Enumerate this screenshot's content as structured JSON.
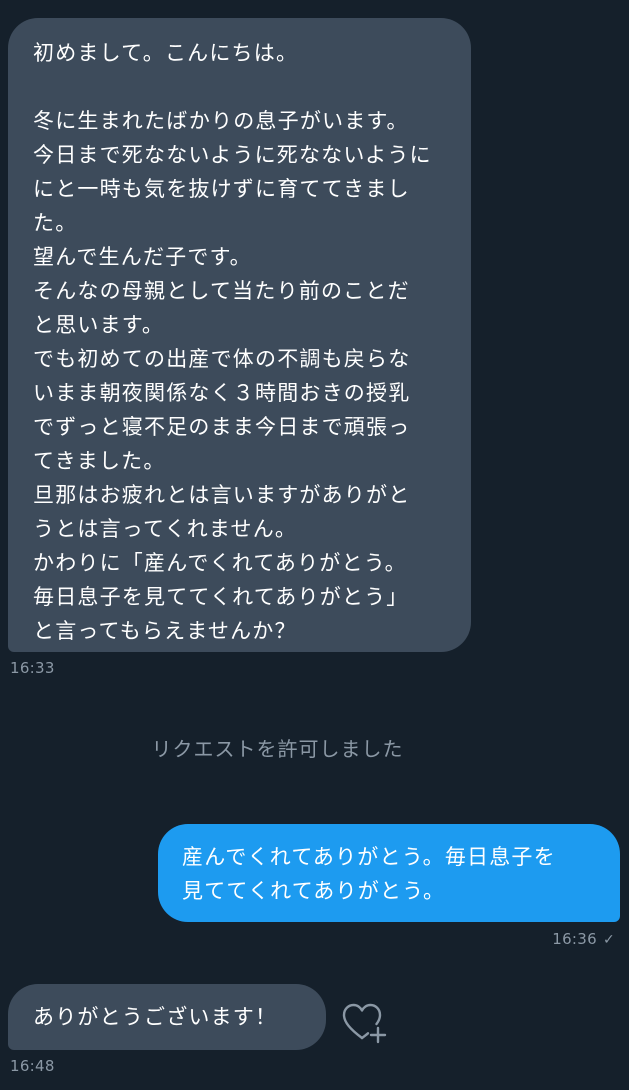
{
  "conversation": {
    "messages": [
      {
        "direction": "incoming",
        "text": "初めまして。こんにちは。\n\n冬に生まれたばかりの息子がいます。\n今日まで死なないように死なないように\nにと一時も気を抜けずに育ててきまし\nた。\n望んで生んだ子です。\nそんなの母親として当たり前のことだ\nと思います。\nでも初めての出産で体の不調も戻らな\nいまま朝夜関係なく３時間おきの授乳\nでずっと寝不足のまま今日まで頑張っ\nてきました。\n旦那はお疲れとは言いますがありがと\nうとは言ってくれません。\nかわりに「産んでくれてありがとう。\n毎日息子を見ててくれてありがとう」\nと言ってもらえませんか？",
        "time": "16:33"
      },
      {
        "direction": "outgoing",
        "text": "産んでくれてありがとう。毎日息子を\n見ててくれてありがとう。",
        "time": "16:36",
        "status_icon": "✓"
      },
      {
        "direction": "incoming",
        "text": "ありがとうございます！",
        "time": "16:48"
      }
    ],
    "system_note": "リクエストを許可しました",
    "like_icon": "heart-plus-icon"
  },
  "colors": {
    "background": "#15202b",
    "incoming_bubble": "#3d4b5b",
    "outgoing_bubble": "#1d9bf0",
    "muted_text": "#8b98a5"
  }
}
